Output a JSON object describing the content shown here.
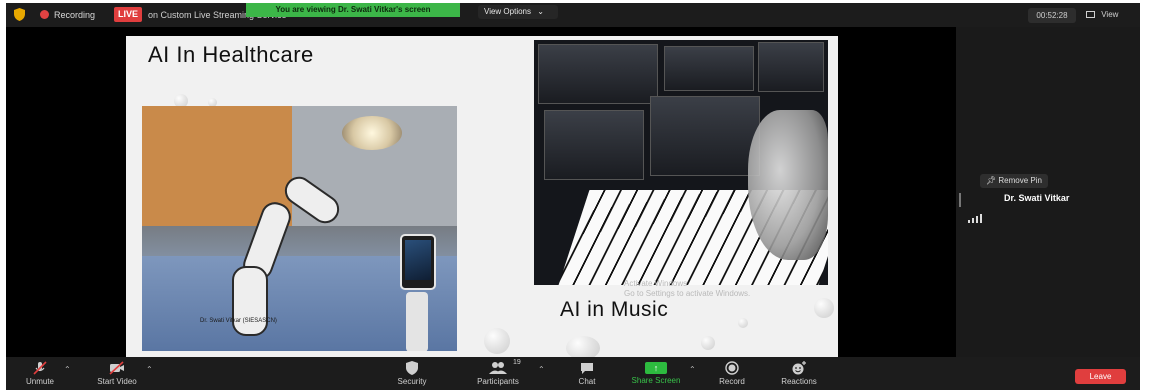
{
  "topbar": {
    "recording_label": "Recording",
    "live_badge": "LIVE",
    "stream_label": "on Custom Live Streaming Service",
    "viewing_banner": "You are viewing Dr. Swati Vitkar's screen",
    "view_options_label": "View Options",
    "meeting_timer": "00:52:28",
    "view_label": "View"
  },
  "slide": {
    "title_left": "AI In Healthcare",
    "title_right": "AI in Music",
    "caption_left": "Dr. Swati Vitkar (SIESASCN)",
    "activate_line1": "Activate Windows",
    "activate_line2": "Go to Settings to activate Windows."
  },
  "side_panel": {
    "remove_pin_label": "Remove Pin",
    "participant_name": "Dr. Swati Vitkar"
  },
  "toolbar": {
    "unmute_label": "Unmute",
    "start_video_label": "Start Video",
    "security_label": "Security",
    "participants_label": "Participants",
    "participants_count": "19",
    "chat_label": "Chat",
    "share_screen_label": "Share Screen",
    "record_label": "Record",
    "reactions_label": "Reactions",
    "leave_label": "Leave"
  },
  "colors": {
    "live_red": "#e03e3e",
    "banner_green": "#3cb648",
    "share_green": "#2dbb3f",
    "leave_red": "#e03e3e"
  }
}
